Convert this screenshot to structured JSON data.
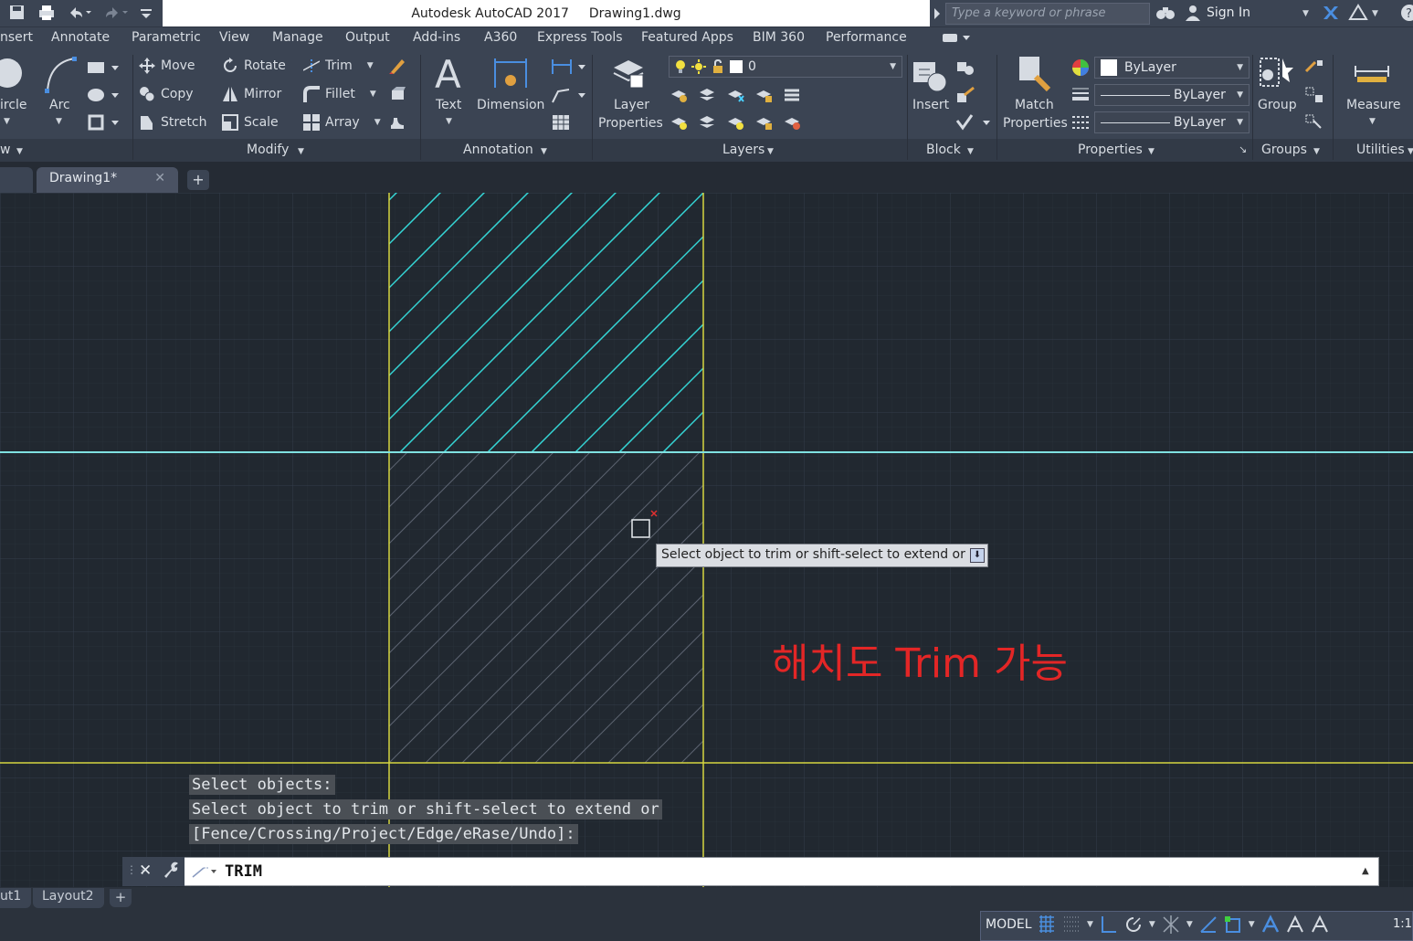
{
  "app": {
    "title": "Autodesk AutoCAD 2017",
    "file": "Drawing1.dwg",
    "search_placeholder": "Type a keyword or phrase",
    "sign_in": "Sign In"
  },
  "menu": [
    "nsert",
    "Annotate",
    "Parametric",
    "View",
    "Manage",
    "Output",
    "Add-ins",
    "A360",
    "Express Tools",
    "Featured Apps",
    "BIM 360",
    "Performance"
  ],
  "ribbon": {
    "draw": {
      "circle": "ircle",
      "arc": "Arc",
      "panel": "w"
    },
    "modify": {
      "move": "Move",
      "rotate": "Rotate",
      "trim": "Trim",
      "copy": "Copy",
      "mirror": "Mirror",
      "fillet": "Fillet",
      "stretch": "Stretch",
      "scale": "Scale",
      "array": "Array",
      "panel": "Modify"
    },
    "annotation": {
      "text": "Text",
      "dimension": "Dimension",
      "panel": "Annotation"
    },
    "layers": {
      "layer_properties_1": "Layer",
      "layer_properties_2": "Properties",
      "current_layer": "0",
      "panel": "Layers"
    },
    "block": {
      "insert": "Insert",
      "panel": "Block"
    },
    "properties": {
      "match_1": "Match",
      "match_2": "Properties",
      "color": "ByLayer",
      "linetype": "ByLayer",
      "lineweight": "ByLayer",
      "panel": "Properties"
    },
    "groups": {
      "group": "Group",
      "panel": "Groups"
    },
    "utilities": {
      "measure": "Measure",
      "panel": "Utilities"
    }
  },
  "tabs": {
    "document": "Drawing1*"
  },
  "canvas": {
    "tooltip": "Select object to trim or shift-select to extend or",
    "annotation": "해치도 Trim 가능",
    "annotation_color": "#e32626"
  },
  "command": {
    "history": [
      "Select objects:",
      "Select object to trim or shift-select to extend or",
      "[Fence/Crossing/Project/Edge/eRase/Undo]:"
    ],
    "input": "TRIM"
  },
  "layouts": [
    "ut1",
    "Layout2"
  ],
  "status": {
    "model": "MODEL",
    "scale": "1:1"
  },
  "colors": {
    "ui_dark": "#3b4453",
    "canvas_bg": "#212830",
    "hatch": "#35d6d6",
    "boundary": "#d6d640"
  }
}
